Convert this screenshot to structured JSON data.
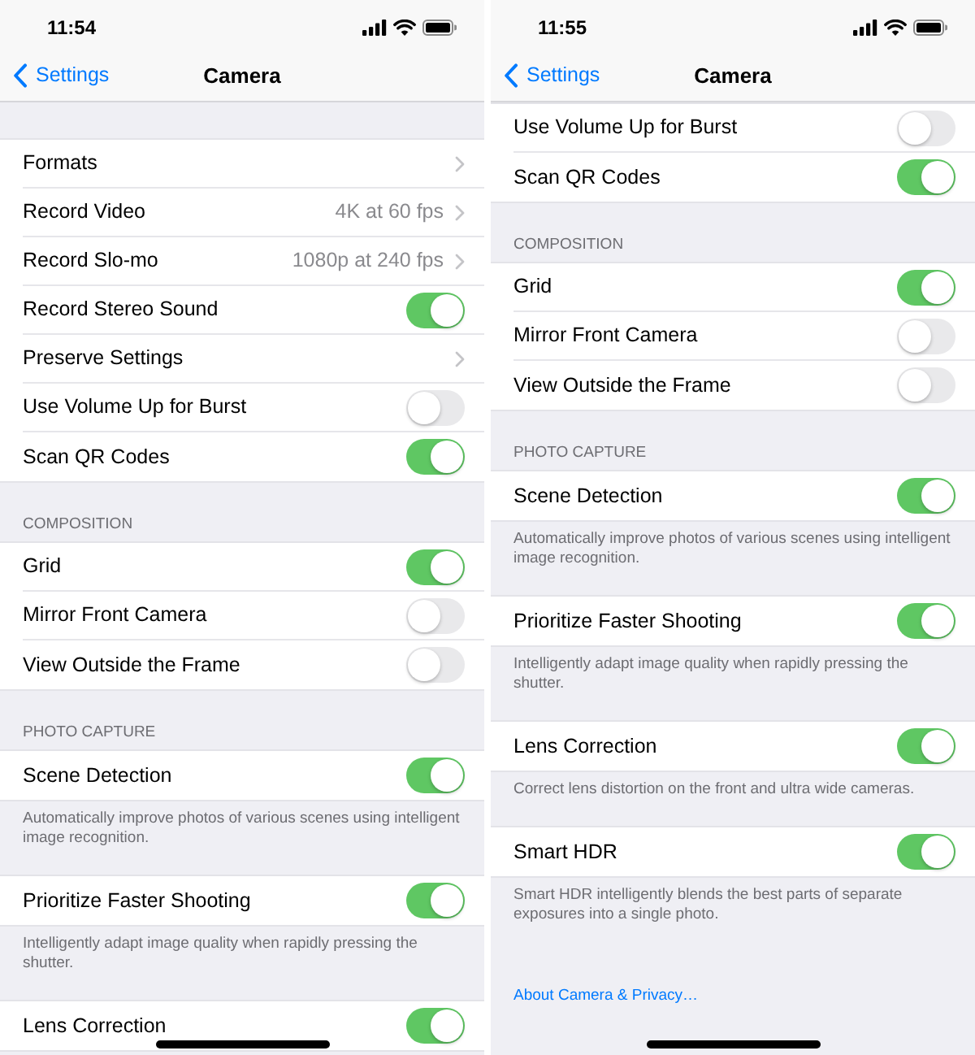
{
  "screens": [
    {
      "status_bar": {
        "time": "11:54"
      },
      "nav_bar": {
        "back_label": "Settings",
        "title": "Camera"
      },
      "groups": [
        {
          "rows": [
            {
              "kind": "link",
              "label": "Formats"
            },
            {
              "kind": "link",
              "label": "Record Video",
              "value": "4K at 60 fps"
            },
            {
              "kind": "link",
              "label": "Record Slo-mo",
              "value": "1080p at 240 fps"
            },
            {
              "kind": "toggle",
              "label": "Record Stereo Sound",
              "on": true
            },
            {
              "kind": "link",
              "label": "Preserve Settings"
            },
            {
              "kind": "toggle",
              "label": "Use Volume Up for Burst",
              "on": false
            },
            {
              "kind": "toggle",
              "label": "Scan QR Codes",
              "on": true
            }
          ]
        },
        {
          "header": "COMPOSITION",
          "rows": [
            {
              "kind": "toggle",
              "label": "Grid",
              "on": true
            },
            {
              "kind": "toggle",
              "label": "Mirror Front Camera",
              "on": false
            },
            {
              "kind": "toggle",
              "label": "View Outside the Frame",
              "on": false
            }
          ]
        },
        {
          "header": "PHOTO CAPTURE",
          "rows": [
            {
              "kind": "toggle",
              "label": "Scene Detection",
              "on": true
            }
          ],
          "footer": "Automatically improve photos of various scenes using intelligent image recognition."
        },
        {
          "rows": [
            {
              "kind": "toggle",
              "label": "Prioritize Faster Shooting",
              "on": true
            }
          ],
          "footer": "Intelligently adapt image quality when rapidly pressing the shutter."
        },
        {
          "rows": [
            {
              "kind": "toggle",
              "label": "Lens Correction",
              "on": true
            }
          ]
        }
      ]
    },
    {
      "status_bar": {
        "time": "11:55"
      },
      "nav_bar": {
        "back_label": "Settings",
        "title": "Camera"
      },
      "groups": [
        {
          "rows": [
            {
              "kind": "toggle",
              "label": "Use Volume Up for Burst",
              "on": false
            },
            {
              "kind": "toggle",
              "label": "Scan QR Codes",
              "on": true
            }
          ]
        },
        {
          "header": "COMPOSITION",
          "rows": [
            {
              "kind": "toggle",
              "label": "Grid",
              "on": true
            },
            {
              "kind": "toggle",
              "label": "Mirror Front Camera",
              "on": false
            },
            {
              "kind": "toggle",
              "label": "View Outside the Frame",
              "on": false
            }
          ]
        },
        {
          "header": "PHOTO CAPTURE",
          "rows": [
            {
              "kind": "toggle",
              "label": "Scene Detection",
              "on": true
            }
          ],
          "footer": "Automatically improve photos of various scenes using intelligent image recognition."
        },
        {
          "rows": [
            {
              "kind": "toggle",
              "label": "Prioritize Faster Shooting",
              "on": true
            }
          ],
          "footer": "Intelligently adapt image quality when rapidly pressing the shutter."
        },
        {
          "rows": [
            {
              "kind": "toggle",
              "label": "Lens Correction",
              "on": true
            }
          ],
          "footer": "Correct lens distortion on the front and ultra wide cameras."
        },
        {
          "rows": [
            {
              "kind": "toggle",
              "label": "Smart HDR",
              "on": true
            }
          ],
          "footer": "Smart HDR intelligently blends the best parts of separate exposures into a single photo."
        }
      ],
      "link": "About Camera & Privacy…"
    }
  ]
}
